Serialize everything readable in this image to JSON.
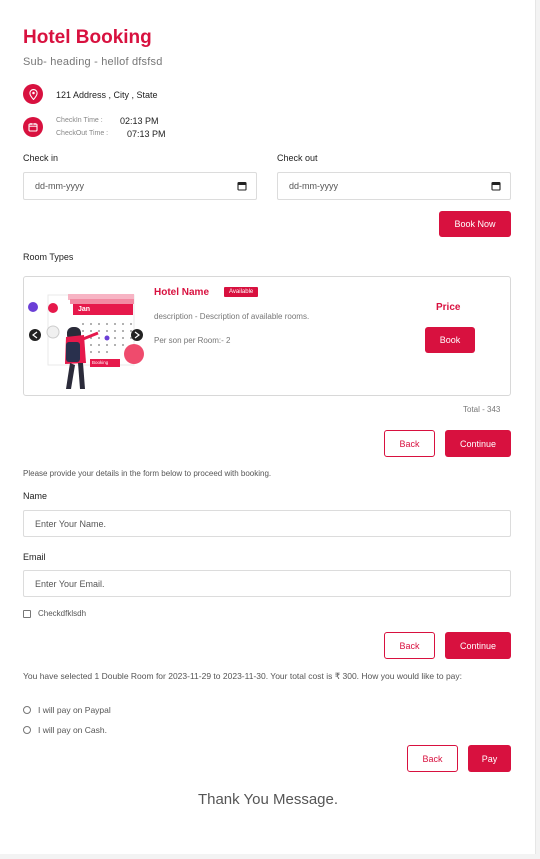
{
  "header": {
    "title": "Hotel Booking",
    "subtitle": "Sub- heading - hellof dfsfsd",
    "address": "121 Address , City , State",
    "checkin_time_label": "CheckIn Time :",
    "checkin_time": "02:13 PM",
    "checkout_time_label": "CheckOut Time :",
    "checkout_time": "07:13 PM"
  },
  "dates": {
    "checkin_label": "Check in",
    "checkin_value": "dd-mm-yyyy",
    "checkout_label": "Check out",
    "checkout_value": "dd-mm-yyyy",
    "book_now": "Book Now"
  },
  "rooms": {
    "section_label": "Room Types",
    "illustration": {
      "month": "Jan",
      "button": "Booking"
    },
    "room": {
      "name": "Hotel Name",
      "badge": "Available",
      "description": "description - Description of available rooms.",
      "per_person": "Per son per Room:- 2",
      "price_label": "Price",
      "book": "Book"
    },
    "total": "Total - 343",
    "back": "Back",
    "continue": "Continue"
  },
  "details": {
    "intro": "Please provide your details in the form below to proceed with booking.",
    "name_label": "Name",
    "name_placeholder": "Enter Your Name.",
    "email_label": "Email",
    "email_placeholder": "Enter Your Email.",
    "checkbox_label": "Checkdfklsdh",
    "back": "Back",
    "continue": "Continue"
  },
  "payment": {
    "summary": "You have selected 1 Double Room for 2023-11-29 to 2023-11-30. Your total cost is ₹ 300. How you would like to pay:",
    "option_paypal": "I will pay on Paypal",
    "option_cash": "I will pay on Cash.",
    "back": "Back",
    "pay": "Pay"
  },
  "thank_you": "Thank You Message.",
  "colors": {
    "accent": "#d8113f",
    "border": "#dcdcdc"
  }
}
